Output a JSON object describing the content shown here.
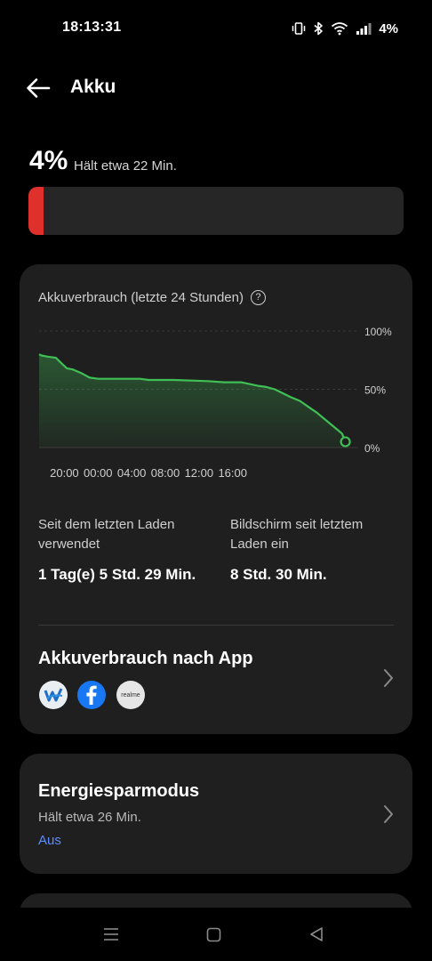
{
  "status_bar": {
    "time": "18:13:31",
    "battery_text": "4%",
    "icons": [
      "vibrate-icon",
      "bluetooth-icon",
      "wifi-icon",
      "signal-icon"
    ]
  },
  "header": {
    "title": "Akku",
    "back_icon": "arrow-left-icon"
  },
  "battery": {
    "percent_label": "4%",
    "remaining": "Hält etwa 22 Min.",
    "level": 0.04,
    "bar_color": "#e0302b"
  },
  "usage_card": {
    "chart_title": "Akkuverbrauch (letzte 24 Stunden)",
    "help_icon": "?",
    "chart_data": {
      "type": "area",
      "title": "Akkuverbrauch (letzte 24 Stunden)",
      "x_tick_labels": [
        "20:00",
        "00:00",
        "04:00",
        "08:00",
        "12:00",
        "16:00"
      ],
      "y_tick_labels": [
        "100%",
        "50%",
        "0%"
      ],
      "ylim": [
        0,
        100
      ],
      "grid": true,
      "color": "#3fbf55",
      "series": [
        {
          "x_hours": [
            0,
            0.3,
            1,
            2,
            2.7,
            3.3,
            4,
            5,
            6,
            7,
            8,
            12,
            13,
            16,
            20,
            22,
            22.5,
            23,
            24,
            26,
            27,
            28,
            30,
            31,
            32,
            33,
            34,
            35,
            36,
            36.4
          ],
          "values": [
            80,
            79,
            78,
            77,
            72,
            68,
            67,
            64,
            60,
            59,
            59,
            59,
            58,
            58,
            57,
            56,
            56,
            56,
            56,
            53,
            52,
            50,
            43,
            40,
            35,
            30,
            24,
            18,
            12,
            5
          ]
        }
      ]
    },
    "since_charge_label": "Seit dem letzten Laden verwendet",
    "since_charge_value": "1 Tag(e) 5 Std. 29 Min.",
    "screen_label": "Bildschirm seit letztem Laden ein",
    "screen_value": "8 Std. 30 Min.",
    "app_usage_title": "Akkuverbrauch nach App",
    "apps": [
      "weather-app-icon",
      "facebook-icon",
      "realme-app-icon"
    ],
    "realme_text": "realme"
  },
  "power_saving": {
    "title": "Energiesparmodus",
    "subtitle": "Hält etwa 26 Min.",
    "state": "Aus"
  }
}
